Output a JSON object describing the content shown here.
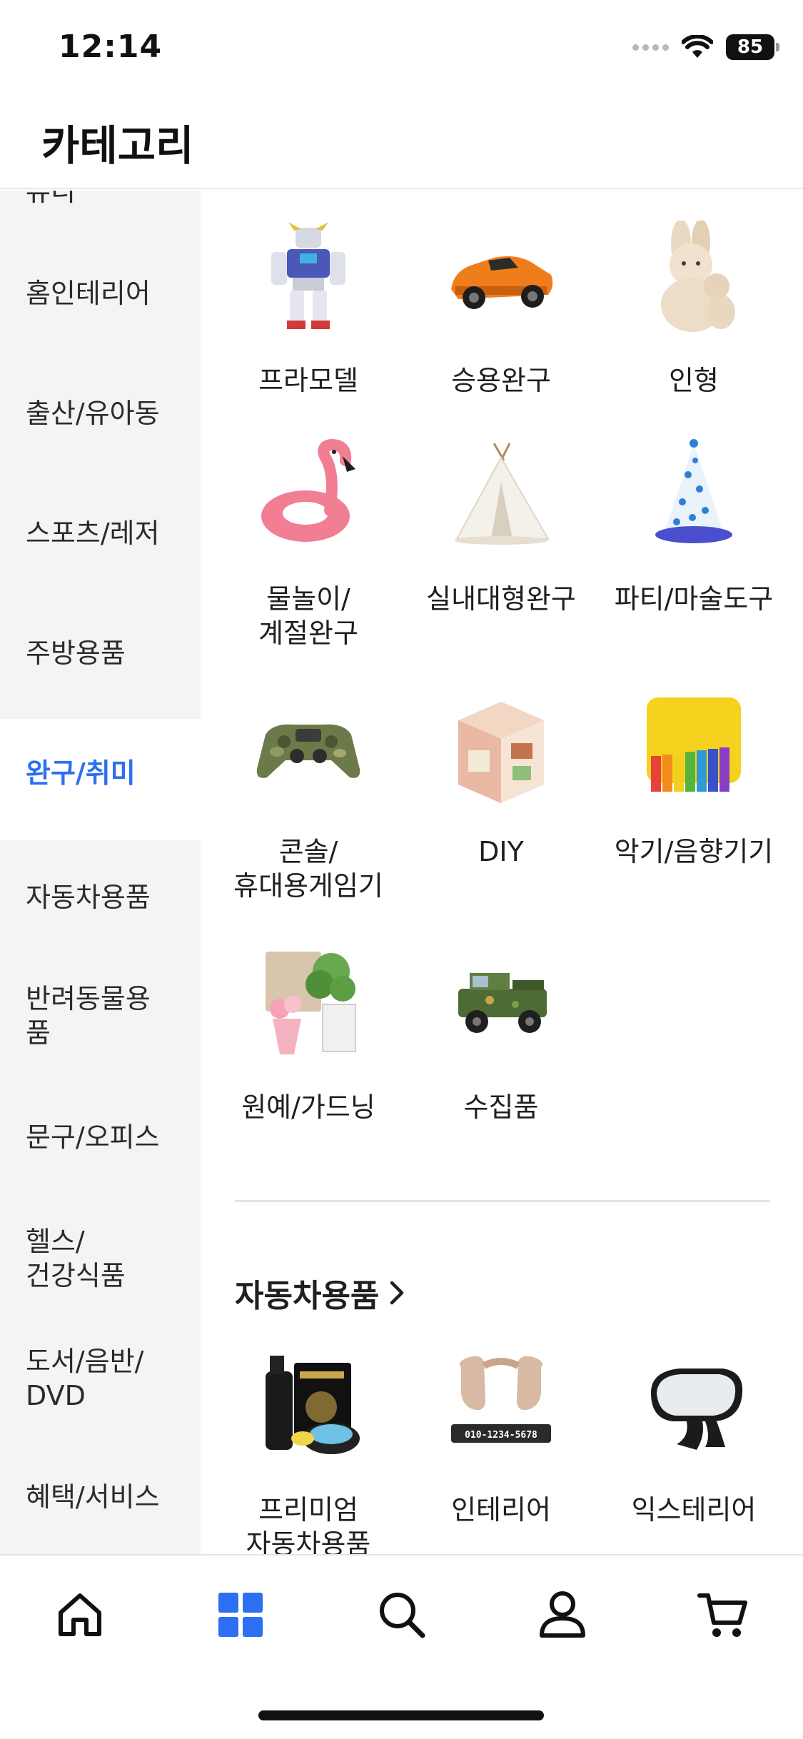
{
  "status_bar": {
    "time": "12:14",
    "battery": "85"
  },
  "header": {
    "title": "카테고리"
  },
  "sidebar": {
    "cutoff_label": "뷰티",
    "items": [
      {
        "label": "홈인테리어",
        "active": false
      },
      {
        "label": "출산/유아동",
        "active": false
      },
      {
        "label": "스포츠/레저",
        "active": false
      },
      {
        "label": "주방용품",
        "active": false
      },
      {
        "label": "완구/취미",
        "active": true
      },
      {
        "label": "자동차용품",
        "active": false
      },
      {
        "label": "반려동물용품",
        "active": false
      },
      {
        "label": "문구/오피스",
        "active": false
      },
      {
        "label": "헬스/\n건강식품",
        "active": false
      },
      {
        "label": "도서/음반/\nDVD",
        "active": false
      },
      {
        "label": "혜택/서비스",
        "active": false
      }
    ]
  },
  "toys_section": {
    "tiles": [
      {
        "label": "프라모델",
        "icon": "robot-model-icon"
      },
      {
        "label": "승용완구",
        "icon": "ride-on-car-icon"
      },
      {
        "label": "인형",
        "icon": "plush-bunny-icon"
      },
      {
        "label": "물놀이/\n계절완구",
        "icon": "flamingo-float-icon"
      },
      {
        "label": "실내대형완구",
        "icon": "teepee-tent-icon"
      },
      {
        "label": "파티/마술도구",
        "icon": "party-hat-icon"
      },
      {
        "label": "콘솔/\n휴대용게임기",
        "icon": "gamepad-icon"
      },
      {
        "label": "DIY",
        "icon": "miniature-room-icon"
      },
      {
        "label": "악기/음향기기",
        "icon": "xylophone-icon"
      },
      {
        "label": "원예/가드닝",
        "icon": "flower-plant-icon"
      },
      {
        "label": "수집품",
        "icon": "toy-jeep-icon"
      }
    ]
  },
  "auto_section": {
    "title": "자동차용품",
    "tiles": [
      {
        "label": "프리미엄\n자동차용품",
        "icon": "car-care-kit-icon"
      },
      {
        "label": "인테리어",
        "icon": "headrest-pillow-icon",
        "plate_text": "010-1234-5678"
      },
      {
        "label": "익스테리어",
        "icon": "side-mirror-icon"
      }
    ]
  },
  "tab_bar": {
    "tabs": [
      {
        "name": "home",
        "active": false
      },
      {
        "name": "category",
        "active": true
      },
      {
        "name": "search",
        "active": false
      },
      {
        "name": "my-page",
        "active": false
      },
      {
        "name": "cart",
        "active": false
      }
    ]
  },
  "colors": {
    "accent": "#2d6ff2",
    "sidebar_bg": "#f2f4f6",
    "divider": "#e3e5e8"
  }
}
